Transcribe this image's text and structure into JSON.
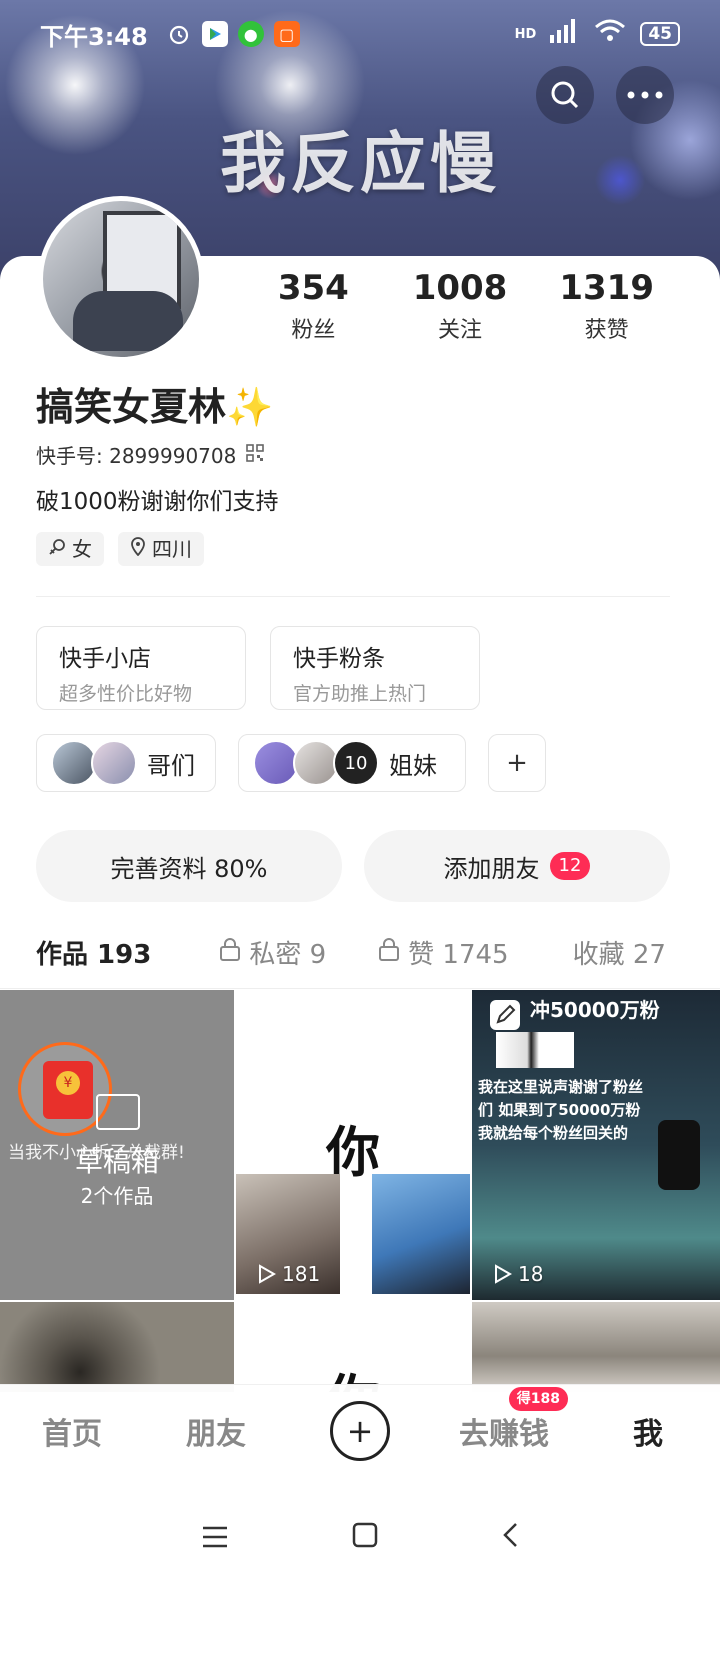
{
  "status_bar": {
    "time": "下午3:48",
    "signal": "HD",
    "battery": "45"
  },
  "banner": {
    "title": "我反应慢"
  },
  "profile": {
    "stats": [
      {
        "value": "354",
        "label": "粉丝"
      },
      {
        "value": "1008",
        "label": "关注"
      },
      {
        "value": "1319",
        "label": "获赞"
      }
    ],
    "name": "搞笑女夏林",
    "name_emoji": "✨",
    "uid": "快手号: 2899990708",
    "bio": "破1000粉谢谢你们支持",
    "gender_tag": "女",
    "location_tag": "四川"
  },
  "services": [
    {
      "title": "快手小店",
      "subtitle": "超多性价比好物"
    },
    {
      "title": "快手粉条",
      "subtitle": "官方助推上热门"
    }
  ],
  "groups": [
    {
      "label": "哥们"
    },
    {
      "label": "姐妹",
      "avatar_count": "10"
    }
  ],
  "actions": {
    "complete_profile": "完善资料 80%",
    "add_friend": "添加朋友",
    "add_friend_badge": "12"
  },
  "tabs": [
    {
      "label": "作品 193"
    },
    {
      "label": "私密 9"
    },
    {
      "label": "赞 1745"
    },
    {
      "label": "收藏 27"
    }
  ],
  "grid": {
    "drafts": {
      "title": "草稿箱",
      "count": "2个作品",
      "overlay_text": "当我不小心拆了总裁群!"
    },
    "cell2": {
      "big_char": "你",
      "plays": "181"
    },
    "cell3": {
      "title": "冲50000万粉",
      "text": "我在这里说声谢谢了粉丝们 如果到了50000万粉我就给每个粉丝回关的",
      "plays": "18"
    },
    "cell5": {
      "big_char": "你"
    }
  },
  "bottom_nav": {
    "home": "首页",
    "friends": "朋友",
    "earn": "去赚钱",
    "earn_badge": "得188",
    "me": "我"
  }
}
